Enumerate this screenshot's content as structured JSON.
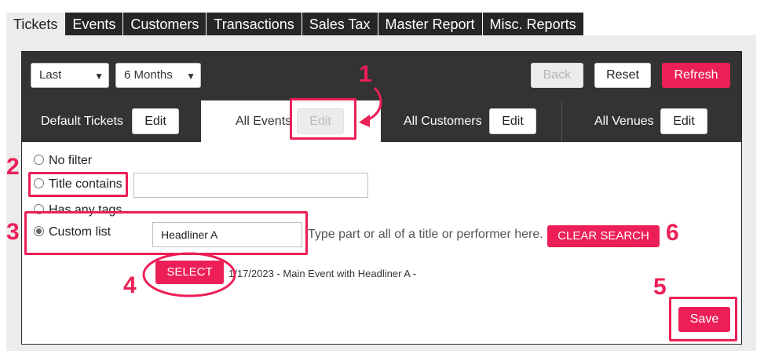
{
  "tabs": [
    "Tickets",
    "Events",
    "Customers",
    "Transactions",
    "Sales Tax",
    "Master Report",
    "Misc. Reports"
  ],
  "toolbar": {
    "range_select": "Last",
    "period_select": "6 Months",
    "back_label": "Back",
    "reset_label": "Reset",
    "refresh_label": "Refresh"
  },
  "filters": {
    "default_tickets": "Default Tickets",
    "all_events": "All Events",
    "all_customers": "All Customers",
    "all_venues": "All Venues",
    "edit_label": "Edit"
  },
  "options": {
    "no_filter": "No filter",
    "title_contains": "Title contains",
    "title_contains_value": "",
    "has_any_tags": "Has any tags",
    "custom_list": "Custom list",
    "custom_list_value": "Headliner A",
    "hint": "Type part or all of a title or performer here.",
    "clear_search_label": "CLEAR SEARCH",
    "select_label": "SELECT",
    "result": "1/17/2023 - Main Event with Headliner A -",
    "save_label": "Save"
  },
  "annotations": [
    "1",
    "2",
    "3",
    "4",
    "5",
    "6"
  ],
  "colors": {
    "accent": "#ec1f57",
    "dark_bar": "#333333",
    "active_tab": "#ececec"
  }
}
